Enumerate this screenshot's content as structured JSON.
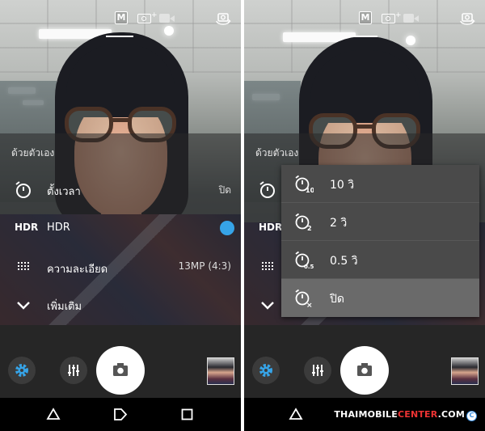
{
  "left_panel": {
    "top_icons": {
      "mode": "M"
    },
    "settings": {
      "header": "ด้วยตัวเอง",
      "rows": [
        {
          "icon": "timer-icon",
          "label": "ตั้งเวลา",
          "value": "ปิด"
        },
        {
          "icon": "hdr-icon",
          "icon_text": "HDR",
          "label": "HDR",
          "toggle_on": true
        },
        {
          "icon": "resolution-icon",
          "label": "ความละเอียด",
          "value": "13MP (4:3)"
        },
        {
          "icon": "chevron-down-icon",
          "label": "เพิ่มเติม"
        }
      ]
    }
  },
  "right_panel": {
    "top_icons": {
      "mode": "M"
    },
    "settings": {
      "header": "ด้วยตัวเอง",
      "hdr_text": "HDR"
    },
    "timer_dropdown": {
      "items": [
        {
          "icon": "timer-10-icon",
          "badge": "10",
          "label": "10 วิ",
          "selected": false
        },
        {
          "icon": "timer-2-icon",
          "badge": "2",
          "label": "2 วิ",
          "selected": false
        },
        {
          "icon": "timer-05-icon",
          "badge": "0.5",
          "label": "0.5 วิ",
          "selected": false
        },
        {
          "icon": "timer-off-icon",
          "badge": "×",
          "label": "ปิด",
          "selected": true
        }
      ]
    }
  },
  "watermark": {
    "text_a": "THAIMOBILE",
    "text_b": "CENTER",
    "text_c": ".COM",
    "mark": "C"
  },
  "colors": {
    "accent": "#36a4e8",
    "panel_bg": "#262626",
    "dropdown_bg": "#4a4a4a",
    "dropdown_selected": "#6a6a6a"
  }
}
